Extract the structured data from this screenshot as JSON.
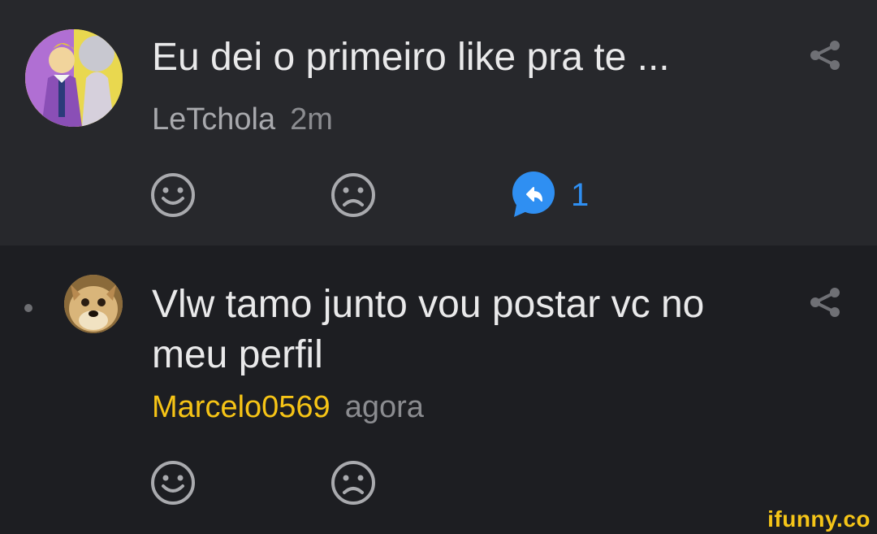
{
  "comments": [
    {
      "text": "Eu dei o primeiro like pra te ...",
      "author": "LeTchola",
      "time": "2m",
      "replies": "1",
      "avatar_icon": "anime-character-avatar",
      "author_color": "#a8a9ad"
    },
    {
      "text": "Vlw tamo junto vou postar vc no meu perfil",
      "author": "Marcelo0569",
      "time": "agora",
      "avatar_icon": "doge-avatar",
      "author_color": "#f6c416"
    }
  ],
  "watermark": "ifunny.co",
  "colors": {
    "reply_accent": "#2f8ff2",
    "top_bg": "#27282c",
    "bottom_bg": "#1d1e22"
  }
}
